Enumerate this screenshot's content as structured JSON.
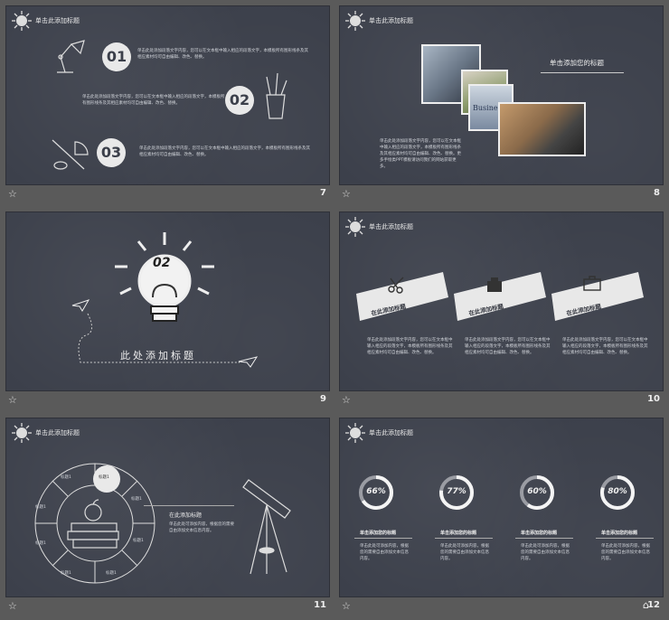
{
  "header_title": "单击此添加标题",
  "footer_icon": "star-outline-icon",
  "slides": [
    {
      "number": "7",
      "items": [
        {
          "num": "01",
          "text": "单击此处添加段落文字内容，您可以在文本框中输入相应的段落文字，本模板所有图形线条及其相应素材均可自由编辑、改色、替换。"
        },
        {
          "num": "02",
          "text": "单击此处添加段落文字内容，您可以在文本框中输入相应的段落文字，本模板所有图形线条及其相应素材均可自由编辑、改色、替换。"
        },
        {
          "num": "03",
          "text": "单击此处添加段落文字内容，您可以在文本框中输入相应的段落文字，本模板所有图形线条及其相应素材均可自由编辑、改色、替换。"
        }
      ]
    },
    {
      "number": "8",
      "title": "单击添加您的标题",
      "text": "单击此处添加段落文字内容，您可以在文本框中输入相应的段落文字，本模板所有图形线条及其相应素材均可自由编辑、改色、替换。更多手绘类PPT模板请访问我们的网站获取更多。",
      "photo_caption": "Business"
    },
    {
      "number": "9",
      "bulb_number": "02",
      "title": "此处添加标题"
    },
    {
      "number": "10",
      "cards": [
        {
          "label": "在此添加标题",
          "text": "单击此处添加段落文字内容，您可以在文本框中输入相应的段落文字，本模板所有图形线条及其相应素材均可自由编辑、改色、替换。"
        },
        {
          "label": "在此添加标题",
          "text": "单击此处添加段落文字内容，您可以在文本框中输入相应的段落文字，本模板所有图形线条及其相应素材均可自由编辑、改色、替换。"
        },
        {
          "label": "在此添加标题",
          "text": "单击此处添加段落文字内容，您可以在文本框中输入相应的段落文字，本模板所有图形线条及其相应素材均可自由编辑、改色、替换。"
        }
      ]
    },
    {
      "number": "11",
      "segments": [
        "标题1",
        "标题1",
        "标题1",
        "标题1",
        "标题1",
        "标题1",
        "标题1",
        "标题1"
      ],
      "title": "在此添加标题",
      "text": "单击此处可添加内容，根据您的需要自由添加文本信息内容。"
    },
    {
      "number": "12",
      "stats": [
        {
          "pct": "66%",
          "value": 0.66,
          "title": "单击添加您的标题",
          "text": "单击此处可添加内容，根据您的需要自由添加文本信息内容。"
        },
        {
          "pct": "77%",
          "value": 0.77,
          "title": "单击添加您的标题",
          "text": "单击此处可添加内容，根据您的需要自由添加文本信息内容。"
        },
        {
          "pct": "60%",
          "value": 0.6,
          "title": "单击添加您的标题",
          "text": "单击此处可添加内容，根据您的需要自由添加文本信息内容。"
        },
        {
          "pct": "80%",
          "value": 0.8,
          "title": "单击添加您的标题",
          "text": "单击此处可添加内容，根据您的需要自由添加文本信息内容。"
        }
      ]
    }
  ]
}
